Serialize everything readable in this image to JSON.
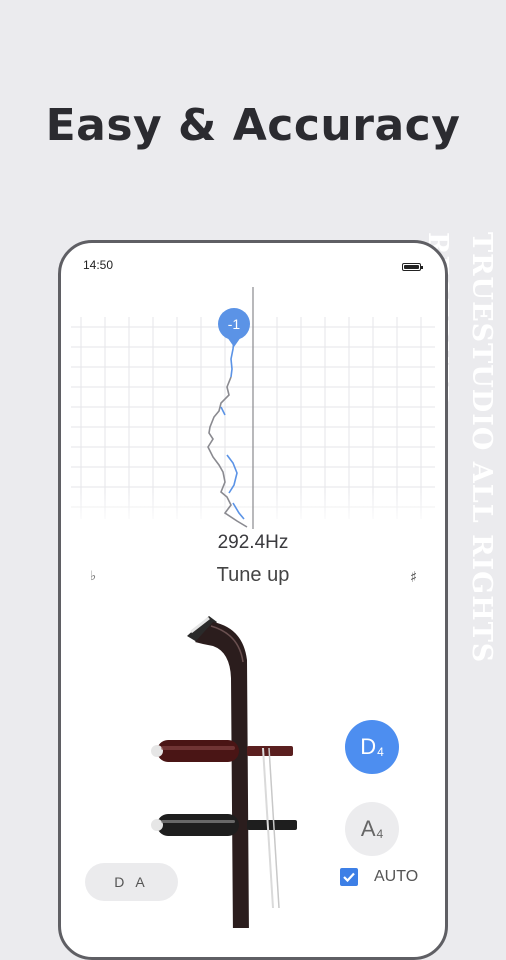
{
  "headline": "Easy & Accuracy",
  "watermark": "TRUESTUDIO ALL RIGHTS RESERVED",
  "status_bar": {
    "time": "14:50"
  },
  "tuner": {
    "cents_offset": "-1",
    "frequency": "292.4Hz",
    "instruction": "Tune up",
    "flat_symbol": "♭",
    "sharp_symbol": "♯"
  },
  "notes": {
    "selected": {
      "letter": "D",
      "octave": "4"
    },
    "other": {
      "letter": "A",
      "octave": "4"
    }
  },
  "auto": {
    "label": "AUTO",
    "checked": true
  },
  "strings_pill": {
    "label": "D A"
  },
  "colors": {
    "accent": "#4d8ef0",
    "background": "#ebebee",
    "erhu_body": "#2b1d1d",
    "peg_red": "#5a1f1f"
  }
}
